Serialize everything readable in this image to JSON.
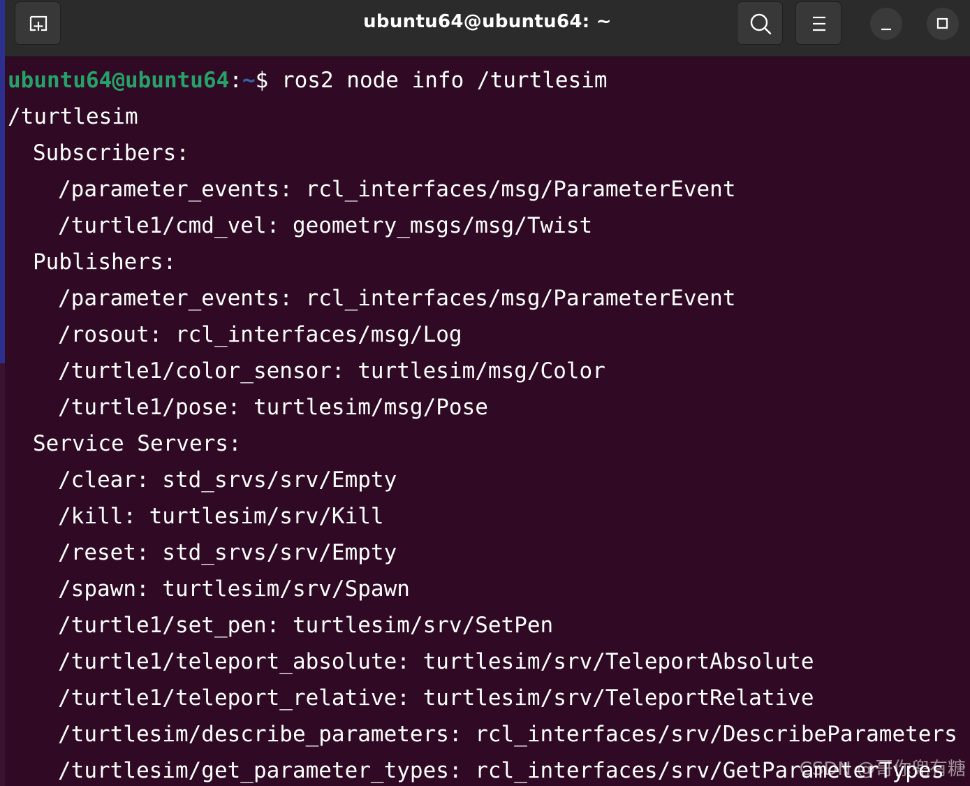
{
  "window": {
    "title": "ubuntu64@ubuntu64: ~",
    "buttons": {
      "new_tab": "new-tab-icon",
      "search": "search-icon",
      "menu": "hamburger-menu-icon",
      "minimize": "minimize-icon",
      "maximize": "maximize-icon"
    }
  },
  "prompt": {
    "user_host": "ubuntu64@ubuntu64",
    "colon": ":",
    "path": "~",
    "dollar": "$",
    "command": "ros2 node info /turtlesim"
  },
  "output": {
    "node": "/turtlesim",
    "subscribers_header": "Subscribers:",
    "subscribers": [
      "/parameter_events: rcl_interfaces/msg/ParameterEvent",
      "/turtle1/cmd_vel: geometry_msgs/msg/Twist"
    ],
    "publishers_header": "Publishers:",
    "publishers": [
      "/parameter_events: rcl_interfaces/msg/ParameterEvent",
      "/rosout: rcl_interfaces/msg/Log",
      "/turtle1/color_sensor: turtlesim/msg/Color",
      "/turtle1/pose: turtlesim/msg/Pose"
    ],
    "service_servers_header": "Service Servers:",
    "service_servers": [
      "/clear: std_srvs/srv/Empty",
      "/kill: turtlesim/srv/Kill",
      "/reset: std_srvs/srv/Empty",
      "/spawn: turtlesim/srv/Spawn",
      "/turtle1/set_pen: turtlesim/srv/SetPen",
      "/turtle1/teleport_absolute: turtlesim/srv/TeleportAbsolute",
      "/turtle1/teleport_relative: turtlesim/srv/TeleportRelative",
      "/turtlesim/describe_parameters: rcl_interfaces/srv/DescribeParameters",
      "/turtlesim/get_parameter_types: rcl_interfaces/srv/GetParameterTypes"
    ]
  },
  "watermark": "CSDN @哥你兜有糖",
  "colors": {
    "background": "#300a24",
    "titlebar": "#2b2b2b",
    "prompt_user": "#26a269",
    "prompt_path": "#3465a4",
    "text": "#ffffff"
  }
}
